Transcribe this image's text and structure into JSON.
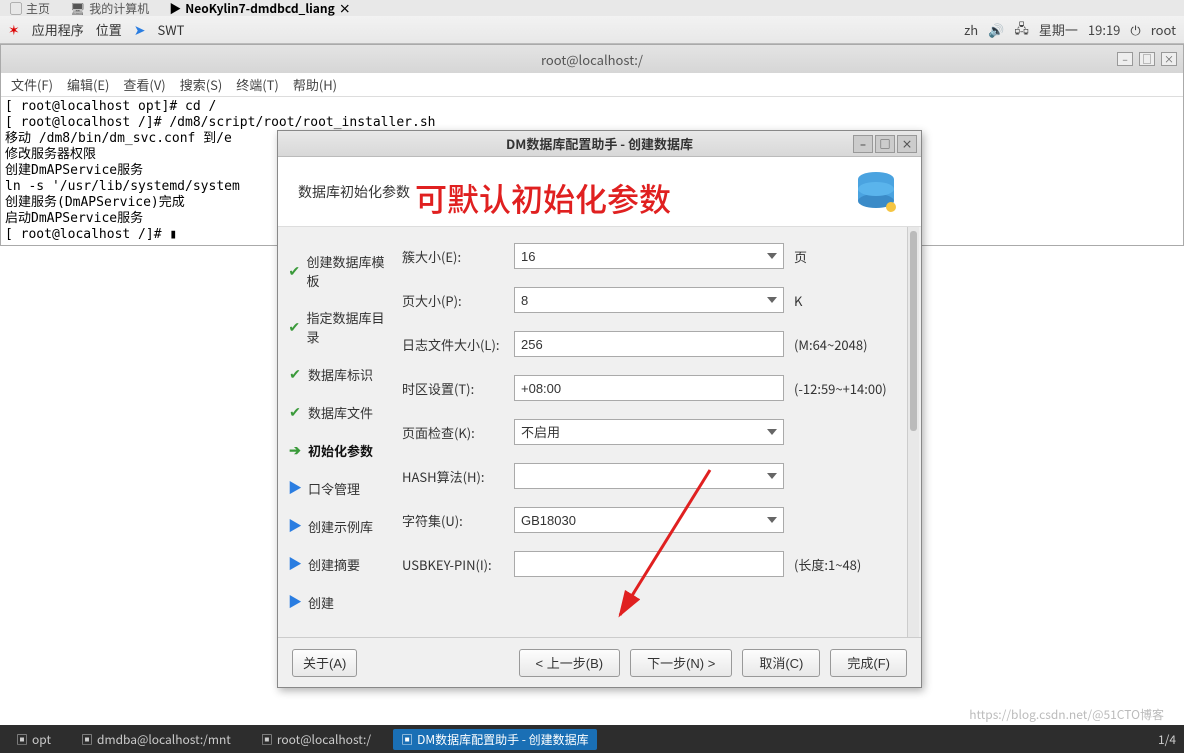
{
  "top_tabs": {
    "t1": "主页",
    "t2": "我的计算机",
    "t3": "NeoKylin7-dmdbcd_liang"
  },
  "menubar": {
    "apps": "应用程序",
    "loc": "位置",
    "swt": "SWT",
    "lang": "zh",
    "day": "星期一",
    "time": "19:19",
    "user": "root"
  },
  "term": {
    "title": "root@localhost:/",
    "menus": {
      "file": "文件(F)",
      "edit": "编辑(E)",
      "view": "查看(V)",
      "search": "搜索(S)",
      "terminal": "终端(T)",
      "help": "帮助(H)"
    },
    "body": "[ root@localhost opt]# cd /\n[ root@localhost /]# /dm8/script/root/root_installer.sh\n移动 /dm8/bin/dm_svc.conf 到/e\n修改服务器权限\n创建DmAPService服务\nln -s '/usr/lib/systemd/system                                            rvice'\n创建服务(DmAPService)完成\n启动DmAPService服务\n[ root@localhost /]# ▮"
  },
  "dialog": {
    "title": "DM数据库配置助手 - 创建数据库",
    "subtitle": "数据库初始化参数",
    "steps": [
      {
        "mark": "✔",
        "label": "创建数据库模板",
        "cls": "done"
      },
      {
        "mark": "✔",
        "label": "指定数据库目录",
        "cls": "done"
      },
      {
        "mark": "✔",
        "label": "数据库标识",
        "cls": "done"
      },
      {
        "mark": "✔",
        "label": "数据库文件",
        "cls": "done"
      },
      {
        "mark": "➔",
        "label": "初始化参数",
        "cls": "current"
      },
      {
        "mark": "▶",
        "label": "口令管理",
        "cls": "pending"
      },
      {
        "mark": "▶",
        "label": "创建示例库",
        "cls": "pending"
      },
      {
        "mark": "▶",
        "label": "创建摘要",
        "cls": "pending"
      },
      {
        "mark": "▶",
        "label": "创建",
        "cls": "pending"
      }
    ],
    "form": {
      "extent_label": "簇大小(E):",
      "extent_value": "16",
      "extent_suffix": "页",
      "page_label": "页大小(P):",
      "page_value": "8",
      "page_suffix": "K",
      "log_label": "日志文件大小(L):",
      "log_value": "256",
      "log_suffix": "(M:64~2048)",
      "tz_label": "时区设置(T):",
      "tz_value": "+08:00",
      "tz_suffix": "(-12:59~+14:00)",
      "check_label": "页面检查(K):",
      "check_value": "不启用",
      "hash_label": "HASH算法(H):",
      "hash_value": "",
      "charset_label": "字符集(U):",
      "charset_value": "GB18030",
      "usb_label": "USBKEY-PIN(I):",
      "usb_value": "",
      "usb_suffix": "(长度:1~48)"
    },
    "buttons": {
      "about": "关于(A)",
      "prev": "< 上一步(B)",
      "next": "下一步(N) >",
      "cancel": "取消(C)",
      "finish": "完成(F)"
    }
  },
  "annotation": "可默认初始化参数",
  "taskbar": {
    "i1": "opt",
    "i2": "dmdba@localhost:/mnt",
    "i3": "root@localhost:/",
    "i4": "DM数据库配置助手 - 创建数据库",
    "right": "1/4"
  },
  "watermark": "https://blog.csdn.net/@51CTO博客"
}
